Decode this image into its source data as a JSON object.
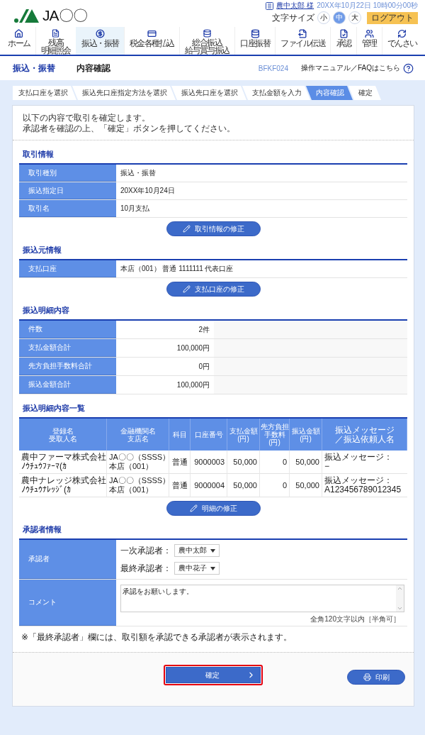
{
  "header": {
    "logo": "JA〇〇",
    "user_name": "農中太郎 様",
    "datetime": "20XX年10月22日 10時00分00秒",
    "font_size_label": "文字サイズ",
    "font_sizes": [
      {
        "label": "小",
        "selected": false
      },
      {
        "label": "中",
        "selected": true
      },
      {
        "label": "大",
        "selected": false
      }
    ],
    "logout": "ログアウト"
  },
  "nav": [
    {
      "label": [
        "ホーム"
      ],
      "selected": false
    },
    {
      "label": [
        "残高",
        "明細照会"
      ],
      "selected": false
    },
    {
      "label": [
        "振込・振替"
      ],
      "selected": true
    },
    {
      "label": [
        "税金各種払込"
      ],
      "selected": false
    },
    {
      "label": [
        "総合振込",
        "給与賞与振込"
      ],
      "selected": false
    },
    {
      "label": [
        "口座振替"
      ],
      "selected": false
    },
    {
      "label": [
        "ファイル伝送"
      ],
      "selected": false
    },
    {
      "label": [
        "承認"
      ],
      "selected": false
    },
    {
      "label": [
        "管理"
      ],
      "selected": false
    },
    {
      "label": [
        "でんさい"
      ],
      "selected": false
    }
  ],
  "page_title": {
    "category": "振込・振替",
    "title": "内容確認",
    "screen_id": "BFKF024",
    "help_link": "操作マニュアル／FAQはこちら"
  },
  "steps": [
    {
      "label": "支払口座を選択",
      "selected": false
    },
    {
      "label": "振込先口座指定方法を選択",
      "selected": false
    },
    {
      "label": "振込先口座を選択",
      "selected": false
    },
    {
      "label": "支払金額を入力",
      "selected": false
    },
    {
      "label": "内容確認",
      "selected": true
    },
    {
      "label": "確定",
      "selected": false
    }
  ],
  "intro": [
    "以下の内容で取引を確定します。",
    "承認者を確認の上、「確定」ボタンを押してください。"
  ],
  "transaction_info": {
    "title": "取引情報",
    "rows": [
      {
        "label": "取引種別",
        "value": "振込・振替"
      },
      {
        "label": "振込指定日",
        "value": "20XX年10月24日"
      },
      {
        "label": "取引名",
        "value": "10月支払"
      }
    ],
    "edit_button": "取引情報の修正"
  },
  "source_info": {
    "title": "振込元情報",
    "rows": [
      {
        "label": "支払口座",
        "value": "本店（001） 普通 1111111 代表口座"
      }
    ],
    "edit_button": "支払口座の修正"
  },
  "summary": {
    "title": "振込明細内容",
    "rows": [
      {
        "label": "件数",
        "value": "2件"
      },
      {
        "label": "支払金額合計",
        "value": "100,000円"
      },
      {
        "label": "先方負担手数料合計",
        "value": "0円"
      },
      {
        "label": "振込金額合計",
        "value": "100,000円"
      }
    ]
  },
  "details": {
    "title": "振込明細内容一覧",
    "columns": [
      {
        "lines": [
          "登録名",
          "受取人名"
        ]
      },
      {
        "lines": [
          "金融機関名",
          "支店名"
        ]
      },
      {
        "lines": [
          "科目"
        ]
      },
      {
        "lines": [
          "口座番号"
        ]
      },
      {
        "lines": [
          "支払金額",
          "(円)"
        ]
      },
      {
        "lines": [
          "先方負担",
          "手数料",
          "(円)"
        ]
      },
      {
        "lines": [
          "振込金額",
          "(円)"
        ]
      },
      {
        "lines": [
          "振込メッセージ",
          "／振込依頼人名"
        ]
      }
    ],
    "rows": [
      {
        "cells": [
          {
            "lines": [
              "農中ファーマ株式会社",
              "ﾉｳﾁｭｳﾌｧｰﾏ(ｶ"
            ]
          },
          {
            "lines": [
              "JA〇〇（SSSS）",
              "本店（001）"
            ]
          },
          {
            "lines": [
              "普通"
            ]
          },
          {
            "lines": [
              "9000003"
            ]
          },
          {
            "lines": [
              "50,000"
            ]
          },
          {
            "lines": [
              "0"
            ]
          },
          {
            "lines": [
              "50,000"
            ]
          },
          {
            "lines": [
              "振込メッセージ：",
              "−"
            ]
          }
        ]
      },
      {
        "cells": [
          {
            "lines": [
              "農中ナレッジ株式会社",
              "ﾉｳﾁｭｳﾅﾚｯｼﾞ(ｶ"
            ]
          },
          {
            "lines": [
              "JA〇〇（SSSS）",
              "本店（001）"
            ]
          },
          {
            "lines": [
              "普通"
            ]
          },
          {
            "lines": [
              "9000004"
            ]
          },
          {
            "lines": [
              "50,000"
            ]
          },
          {
            "lines": [
              "0"
            ]
          },
          {
            "lines": [
              "50,000"
            ]
          },
          {
            "lines": [
              "振込メッセージ：",
              "A123456789012345"
            ]
          }
        ]
      }
    ],
    "edit_button": "明細の修正"
  },
  "approver": {
    "title": "承認者情報",
    "approver_label": "承認者",
    "first_label": "一次承認者：",
    "first_value": "農中太郎",
    "final_label": "最終承認者：",
    "final_value": "農中花子",
    "comment_label": "コメント",
    "comment_value": "承認をお願いします。",
    "comment_hint": "全角120文字以内［半角可］"
  },
  "note": "※「最終承認者」欄には、取引額を承認できる承認者が表示されます。",
  "actions": {
    "confirm": "確定",
    "print": "印刷"
  }
}
